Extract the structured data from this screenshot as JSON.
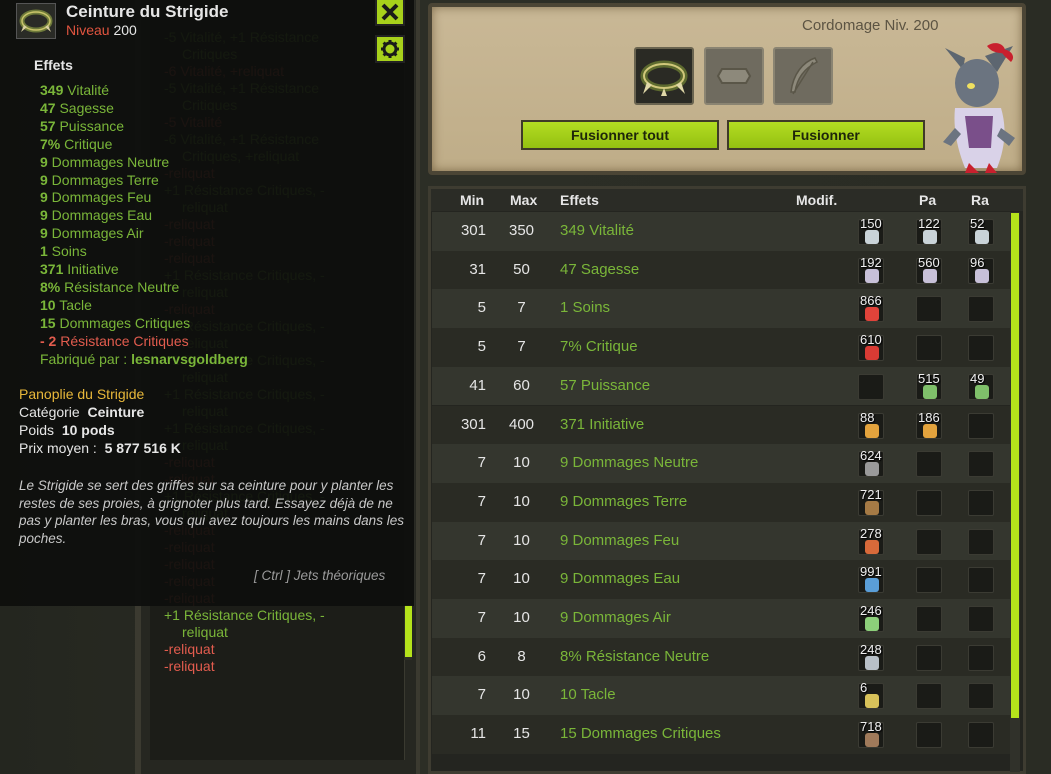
{
  "colors": {
    "bonus": "#7ab639",
    "malus": "#e25c4e",
    "accent": "#b5e31b",
    "set": "#e8b83a"
  },
  "history": [
    {
      "type": "pos",
      "lines": [
        "-5 Vitalité, +1 Résistance",
        "Critiques"
      ]
    },
    {
      "type": "neg",
      "lines": [
        "-6 Vitalité, +reliquat"
      ]
    },
    {
      "type": "pos",
      "lines": [
        "-5 Vitalité, +1 Résistance",
        "Critiques"
      ]
    },
    {
      "type": "neg",
      "lines": [
        "-5 Vitalité"
      ]
    },
    {
      "type": "pos",
      "lines": [
        "-6 Vitalité, +1 Résistance",
        "Critiques, +reliquat"
      ]
    },
    {
      "type": "neg",
      "lines": [
        "-reliquat"
      ]
    },
    {
      "type": "pos",
      "lines": [
        "+1 Résistance Critiques, -",
        "reliquat"
      ]
    },
    {
      "type": "neg",
      "lines": [
        "-reliquat"
      ]
    },
    {
      "type": "neg",
      "lines": [
        "-reliquat"
      ]
    },
    {
      "type": "neg",
      "lines": [
        "-reliquat"
      ]
    },
    {
      "type": "pos",
      "lines": [
        "+1 Résistance Critiques, -",
        "reliquat"
      ]
    },
    {
      "type": "neg",
      "lines": [
        "-reliquat"
      ]
    },
    {
      "type": "pos",
      "lines": [
        "+1 Résistance Critiques, -",
        "reliquat"
      ]
    },
    {
      "type": "pos",
      "lines": [
        "+1 Résistance Critiques, -",
        "reliquat"
      ]
    },
    {
      "type": "pos",
      "lines": [
        "+1 Résistance Critiques, -",
        "reliquat"
      ]
    },
    {
      "type": "pos",
      "lines": [
        "+1 Résistance Critiques, -",
        "reliquat"
      ]
    },
    {
      "type": "neg",
      "lines": [
        "-reliquat"
      ]
    },
    {
      "type": "neg",
      "lines": [
        "-reliquat"
      ]
    },
    {
      "type": "pos",
      "lines": [
        "+1 Résistance Critiques, -",
        "reliquat"
      ]
    },
    {
      "type": "neg",
      "lines": [
        "-reliquat"
      ]
    },
    {
      "type": "neg",
      "lines": [
        "-reliquat"
      ]
    },
    {
      "type": "neg",
      "lines": [
        "-reliquat"
      ]
    },
    {
      "type": "neg",
      "lines": [
        "-reliquat"
      ]
    },
    {
      "type": "neg",
      "lines": [
        "-reliquat"
      ]
    },
    {
      "type": "pos",
      "lines": [
        "+1 Résistance Critiques, -",
        "reliquat"
      ]
    },
    {
      "type": "neg",
      "lines": [
        "-reliquat"
      ]
    },
    {
      "type": "neg",
      "lines": [
        "-reliquat"
      ]
    }
  ],
  "tooltip": {
    "name": "Ceinture du Strigide",
    "level_label": "Niveau",
    "level": "200",
    "effects_title": "Effets",
    "effects": [
      {
        "value": "349",
        "label": "Vitalité",
        "type": "pos"
      },
      {
        "value": "47",
        "label": "Sagesse",
        "type": "pos"
      },
      {
        "value": "57",
        "label": "Puissance",
        "type": "pos"
      },
      {
        "value": "7%",
        "label": "Critique",
        "type": "pos"
      },
      {
        "value": "9",
        "label": "Dommages Neutre",
        "type": "pos"
      },
      {
        "value": "9",
        "label": "Dommages Terre",
        "type": "pos"
      },
      {
        "value": "9",
        "label": "Dommages Feu",
        "type": "pos"
      },
      {
        "value": "9",
        "label": "Dommages Eau",
        "type": "pos"
      },
      {
        "value": "9",
        "label": "Dommages Air",
        "type": "pos"
      },
      {
        "value": "1",
        "label": "Soins",
        "type": "pos"
      },
      {
        "value": "371",
        "label": "Initiative",
        "type": "pos"
      },
      {
        "value": "8%",
        "label": "Résistance Neutre",
        "type": "pos"
      },
      {
        "value": "10",
        "label": "Tacle",
        "type": "pos"
      },
      {
        "value": "15",
        "label": "Dommages Critiques",
        "type": "pos"
      },
      {
        "value": "- 2",
        "label": "Résistance Critiques",
        "type": "neg"
      }
    ],
    "crafted_label": "Fabriqué par :",
    "crafted_by": "lesnarvsgoldberg",
    "set_name": "Panoplie du Strigide",
    "category_label": "Catégorie",
    "category": "Ceinture",
    "weight_label": "Poids",
    "weight": "10 pods",
    "price_label": "Prix moyen :",
    "price": "5 877 516 K",
    "description": "Le Strigide se sert des griffes sur sa ceinture pour y planter les restes de ses proies, à grignoter plus tard. Essayez déjà de ne pas y planter les bras, vous qui avez toujours les mains dans les poches.",
    "ctrl_hint": "[ Ctrl ] Jets théoriques"
  },
  "forge": {
    "job_label": "Cordomage Niv. 200",
    "fuse_all_label": "Fusionner tout",
    "fuse_label": "Fusionner"
  },
  "table": {
    "headers": {
      "min": "Min",
      "max": "Max",
      "effects": "Effets",
      "modif": "Modif.",
      "pa": "Pa",
      "ra": "Ra"
    },
    "rows": [
      {
        "min": "301",
        "max": "350",
        "effect": "349 Vitalité",
        "runes": [
          "150",
          "122",
          "52"
        ],
        "rune_color": "#c9d3d8"
      },
      {
        "min": "31",
        "max": "50",
        "effect": "47 Sagesse",
        "runes": [
          "192",
          "560",
          "96"
        ],
        "rune_color": "#c7c0d8"
      },
      {
        "min": "5",
        "max": "7",
        "effect": "1 Soins",
        "runes": [
          "866",
          "",
          ""
        ],
        "rune_color": "#e0433a"
      },
      {
        "min": "5",
        "max": "7",
        "effect": "7% Critique",
        "runes": [
          "610",
          "",
          ""
        ],
        "rune_color": "#d93b34"
      },
      {
        "min": "41",
        "max": "60",
        "effect": "57 Puissance",
        "runes": [
          "",
          "515",
          "49"
        ],
        "rune_color": "#7fc06a"
      },
      {
        "min": "301",
        "max": "400",
        "effect": "371 Initiative",
        "runes": [
          "88",
          "186",
          ""
        ],
        "rune_color": "#e3a33d"
      },
      {
        "min": "7",
        "max": "10",
        "effect": "9 Dommages Neutre",
        "runes": [
          "624",
          "",
          ""
        ],
        "rune_color": "#9a9a9a"
      },
      {
        "min": "7",
        "max": "10",
        "effect": "9 Dommages Terre",
        "runes": [
          "721",
          "",
          ""
        ],
        "rune_color": "#a57a45"
      },
      {
        "min": "7",
        "max": "10",
        "effect": "9 Dommages Feu",
        "runes": [
          "278",
          "",
          ""
        ],
        "rune_color": "#d86a3a"
      },
      {
        "min": "7",
        "max": "10",
        "effect": "9 Dommages Eau",
        "runes": [
          "991",
          "",
          ""
        ],
        "rune_color": "#5a9ed8"
      },
      {
        "min": "7",
        "max": "10",
        "effect": "9 Dommages Air",
        "runes": [
          "246",
          "",
          ""
        ],
        "rune_color": "#8ccf7a"
      },
      {
        "min": "6",
        "max": "8",
        "effect": "8% Résistance Neutre",
        "runes": [
          "248",
          "",
          ""
        ],
        "rune_color": "#b8c0c8"
      },
      {
        "min": "7",
        "max": "10",
        "effect": "10 Tacle",
        "runes": [
          "6",
          "",
          ""
        ],
        "rune_color": "#d8c25a"
      },
      {
        "min": "11",
        "max": "15",
        "effect": "15 Dommages Critiques",
        "runes": [
          "718",
          "",
          ""
        ],
        "rune_color": "#a07a5a"
      }
    ]
  },
  "icons": {
    "close": "close-icon",
    "settings": "gear-icon",
    "item": "belt-icon",
    "rune_slot": "rune-slot-icon",
    "feather_slot": "feather-icon"
  }
}
